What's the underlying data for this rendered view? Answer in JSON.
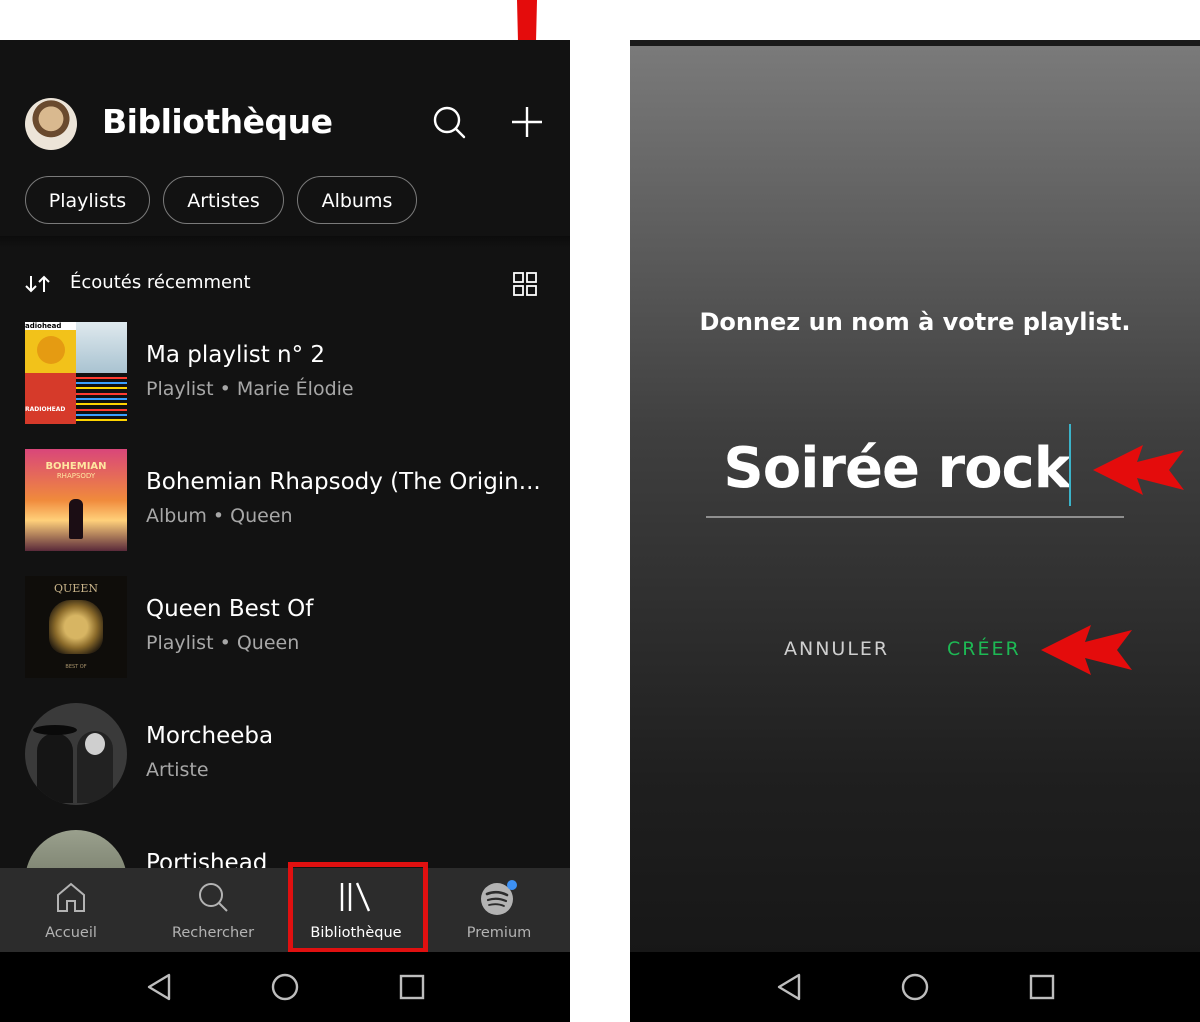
{
  "library": {
    "title": "Bibliothèque",
    "filters": [
      "Playlists",
      "Artistes",
      "Albums"
    ],
    "sort_label": "Écoutés récemment",
    "items": [
      {
        "title": "Ma playlist n° 2",
        "subtitle": "Playlist • Marie Élodie"
      },
      {
        "title": "Bohemian Rhapsody (The Origin...",
        "subtitle": "Album • Queen"
      },
      {
        "title": "Queen Best Of",
        "subtitle": "Playlist • Queen"
      },
      {
        "title": "Morcheeba",
        "subtitle": "Artiste"
      },
      {
        "title": "Portishead",
        "subtitle": ""
      }
    ],
    "cover_text": {
      "radiohead_top": "adiohead",
      "radiohead_bottom": "RADIOHEAD",
      "bohemian": "BOHEMIAN",
      "rhapsody": "RHAPSODY",
      "queen_top": "QUEEN",
      "queen_bottom": "BEST OF"
    }
  },
  "nav": {
    "items": [
      {
        "label": "Accueil",
        "icon": "home-icon"
      },
      {
        "label": "Rechercher",
        "icon": "search-icon"
      },
      {
        "label": "Bibliothèque",
        "icon": "library-icon"
      },
      {
        "label": "Premium",
        "icon": "spotify-icon"
      }
    ],
    "active": "Bibliothèque"
  },
  "dialog": {
    "title": "Donnez un nom à votre playlist.",
    "input_value": "Soirée rock",
    "cancel_label": "ANNULER",
    "create_label": "CRÉER"
  },
  "colors": {
    "background": "#121212",
    "accent_green": "#1db954",
    "annotation_red": "#e01010",
    "cursor": "#3bb3c9",
    "secondary_text": "#a7a7a7"
  }
}
